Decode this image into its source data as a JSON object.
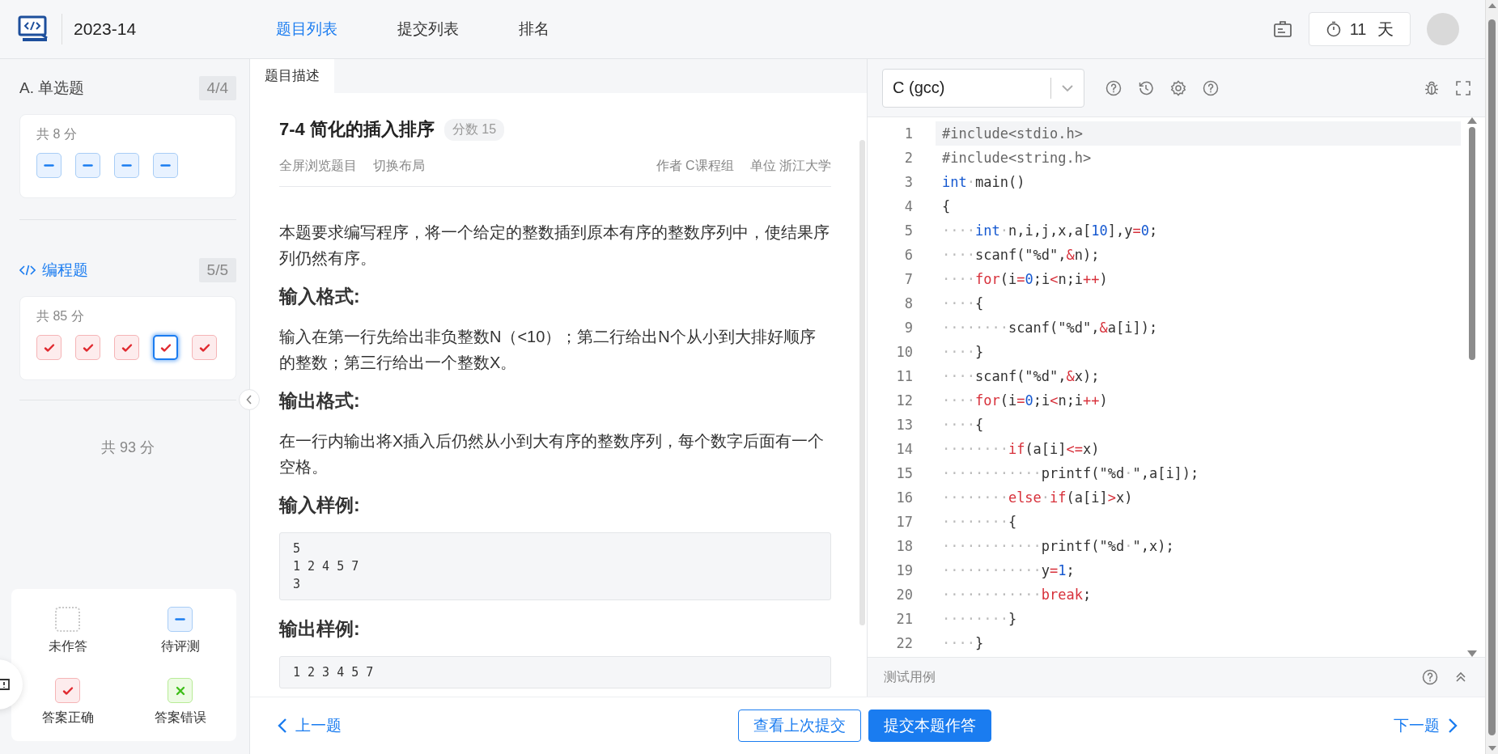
{
  "header": {
    "contest": "2023-14",
    "tabs": [
      {
        "label": "题目列表",
        "selected": true
      },
      {
        "label": "提交列表",
        "selected": false
      },
      {
        "label": "排名",
        "selected": false
      }
    ],
    "timer": "11 天"
  },
  "sidebar": {
    "sections": [
      {
        "kind": "choice",
        "prefix": "A.",
        "title": "单选题",
        "progress": "4/4",
        "selected": false,
        "score": "共 8 分",
        "items": [
          {
            "kind": "pending",
            "selected": false
          },
          {
            "kind": "pending",
            "selected": false
          },
          {
            "kind": "pending",
            "selected": false
          },
          {
            "kind": "pending",
            "selected": false
          }
        ]
      },
      {
        "kind": "code",
        "title": "编程题",
        "progress": "5/5",
        "selected": true,
        "score": "共 85 分",
        "items": [
          {
            "kind": "correct",
            "selected": false
          },
          {
            "kind": "correct",
            "selected": false
          },
          {
            "kind": "correct",
            "selected": false
          },
          {
            "kind": "correct",
            "selected": true
          },
          {
            "kind": "correct",
            "selected": false
          }
        ]
      }
    ],
    "total": "共 93 分",
    "legend": [
      {
        "kind": "unanswered",
        "label": "未作答"
      },
      {
        "kind": "pending",
        "label": "待评测"
      },
      {
        "kind": "correct",
        "label": "答案正确"
      },
      {
        "kind": "wrong",
        "label": "答案错误"
      }
    ]
  },
  "problem": {
    "tabs": [
      {
        "label": "题目描述",
        "selected": true
      }
    ],
    "title": "7-4 简化的插入排序",
    "score": "分数 15",
    "links": [
      "全屏浏览题目",
      "切换布局"
    ],
    "author": "作者 C课程组",
    "unit": "单位 浙江大学",
    "blocks": [
      {
        "kind": "p",
        "text": "本题要求编写程序，将一个给定的整数插到原本有序的整数序列中，使结果序列仍然有序。"
      },
      {
        "kind": "h",
        "text": "输入格式:"
      },
      {
        "kind": "p",
        "text": "输入在第一行先给出非负整数N（<10）；第二行给出N个从小到大排好顺序的整数；第三行给出一个整数X。"
      },
      {
        "kind": "h",
        "text": "输出格式:"
      },
      {
        "kind": "p",
        "text": "在一行内输出将X插入后仍然从小到大有序的整数序列，每个数字后面有一个空格。"
      },
      {
        "kind": "h",
        "text": "输入样例:"
      },
      {
        "kind": "pre",
        "text": "5\n1 2 4 5 7\n3"
      },
      {
        "kind": "h",
        "text": "输出样例:"
      },
      {
        "kind": "pre",
        "text": "1 2 3 4 5 7"
      }
    ]
  },
  "editor": {
    "language": "C (gcc)",
    "lines": [
      {
        "number": "1",
        "active": true,
        "tokens": [
          {
            "kind": "pp",
            "text": "#include<stdio.h>"
          }
        ]
      },
      {
        "number": "2",
        "active": false,
        "tokens": [
          {
            "kind": "pp",
            "text": "#include<string.h>"
          }
        ]
      },
      {
        "number": "3",
        "active": false,
        "tokens": [
          {
            "kind": "kw",
            "text": "int"
          },
          {
            "kind": "ws",
            "text": "·"
          },
          {
            "kind": "tx",
            "text": "main()"
          }
        ]
      },
      {
        "number": "4",
        "active": false,
        "tokens": [
          {
            "kind": "tx",
            "text": "{"
          }
        ]
      },
      {
        "number": "5",
        "active": false,
        "tokens": [
          {
            "kind": "ws",
            "text": "····"
          },
          {
            "kind": "kw",
            "text": "int"
          },
          {
            "kind": "ws",
            "text": "·"
          },
          {
            "kind": "tx",
            "text": "n,i,j,x,a["
          },
          {
            "kind": "num",
            "text": "10"
          },
          {
            "kind": "tx",
            "text": "],y"
          },
          {
            "kind": "op",
            "text": "="
          },
          {
            "kind": "num",
            "text": "0"
          },
          {
            "kind": "tx",
            "text": ";"
          }
        ]
      },
      {
        "number": "6",
        "active": false,
        "tokens": [
          {
            "kind": "ws",
            "text": "····"
          },
          {
            "kind": "tx",
            "text": "scanf(\"%d\","
          },
          {
            "kind": "op",
            "text": "&"
          },
          {
            "kind": "tx",
            "text": "n);"
          }
        ]
      },
      {
        "number": "7",
        "active": false,
        "tokens": [
          {
            "kind": "ws",
            "text": "····"
          },
          {
            "kind": "ctl",
            "text": "for"
          },
          {
            "kind": "tx",
            "text": "(i"
          },
          {
            "kind": "op",
            "text": "="
          },
          {
            "kind": "num",
            "text": "0"
          },
          {
            "kind": "tx",
            "text": ";i"
          },
          {
            "kind": "op",
            "text": "<"
          },
          {
            "kind": "tx",
            "text": "n;i"
          },
          {
            "kind": "op",
            "text": "++"
          },
          {
            "kind": "tx",
            "text": ")"
          }
        ]
      },
      {
        "number": "8",
        "active": false,
        "tokens": [
          {
            "kind": "ws",
            "text": "····"
          },
          {
            "kind": "tx",
            "text": "{"
          }
        ]
      },
      {
        "number": "9",
        "active": false,
        "tokens": [
          {
            "kind": "ws",
            "text": "········"
          },
          {
            "kind": "tx",
            "text": "scanf(\"%d\","
          },
          {
            "kind": "op",
            "text": "&"
          },
          {
            "kind": "tx",
            "text": "a[i]);"
          }
        ]
      },
      {
        "number": "10",
        "active": false,
        "tokens": [
          {
            "kind": "ws",
            "text": "····"
          },
          {
            "kind": "tx",
            "text": "}"
          }
        ]
      },
      {
        "number": "11",
        "active": false,
        "tokens": [
          {
            "kind": "ws",
            "text": "····"
          },
          {
            "kind": "tx",
            "text": "scanf(\"%d\","
          },
          {
            "kind": "op",
            "text": "&"
          },
          {
            "kind": "tx",
            "text": "x);"
          }
        ]
      },
      {
        "number": "12",
        "active": false,
        "tokens": [
          {
            "kind": "ws",
            "text": "····"
          },
          {
            "kind": "ctl",
            "text": "for"
          },
          {
            "kind": "tx",
            "text": "(i"
          },
          {
            "kind": "op",
            "text": "="
          },
          {
            "kind": "num",
            "text": "0"
          },
          {
            "kind": "tx",
            "text": ";i"
          },
          {
            "kind": "op",
            "text": "<"
          },
          {
            "kind": "tx",
            "text": "n;i"
          },
          {
            "kind": "op",
            "text": "++"
          },
          {
            "kind": "tx",
            "text": ")"
          }
        ]
      },
      {
        "number": "13",
        "active": false,
        "tokens": [
          {
            "kind": "ws",
            "text": "····"
          },
          {
            "kind": "tx",
            "text": "{"
          }
        ]
      },
      {
        "number": "14",
        "active": false,
        "tokens": [
          {
            "kind": "ws",
            "text": "········"
          },
          {
            "kind": "ctl",
            "text": "if"
          },
          {
            "kind": "tx",
            "text": "(a[i]"
          },
          {
            "kind": "op",
            "text": "<="
          },
          {
            "kind": "tx",
            "text": "x)"
          }
        ]
      },
      {
        "number": "15",
        "active": false,
        "tokens": [
          {
            "kind": "ws",
            "text": "············"
          },
          {
            "kind": "tx",
            "text": "printf(\"%d"
          },
          {
            "kind": "ws",
            "text": "·"
          },
          {
            "kind": "tx",
            "text": "\",a[i]);"
          }
        ]
      },
      {
        "number": "16",
        "active": false,
        "tokens": [
          {
            "kind": "ws",
            "text": "········"
          },
          {
            "kind": "ctl",
            "text": "else"
          },
          {
            "kind": "ws",
            "text": "·"
          },
          {
            "kind": "ctl",
            "text": "if"
          },
          {
            "kind": "tx",
            "text": "(a[i]"
          },
          {
            "kind": "op",
            "text": ">"
          },
          {
            "kind": "tx",
            "text": "x)"
          }
        ]
      },
      {
        "number": "17",
        "active": false,
        "tokens": [
          {
            "kind": "ws",
            "text": "········"
          },
          {
            "kind": "tx",
            "text": "{"
          }
        ]
      },
      {
        "number": "18",
        "active": false,
        "tokens": [
          {
            "kind": "ws",
            "text": "············"
          },
          {
            "kind": "tx",
            "text": "printf(\"%d"
          },
          {
            "kind": "ws",
            "text": "·"
          },
          {
            "kind": "tx",
            "text": "\",x);"
          }
        ]
      },
      {
        "number": "19",
        "active": false,
        "tokens": [
          {
            "kind": "ws",
            "text": "············"
          },
          {
            "kind": "tx",
            "text": "y"
          },
          {
            "kind": "op",
            "text": "="
          },
          {
            "kind": "num",
            "text": "1"
          },
          {
            "kind": "tx",
            "text": ";"
          }
        ]
      },
      {
        "number": "20",
        "active": false,
        "tokens": [
          {
            "kind": "ws",
            "text": "············"
          },
          {
            "kind": "ctl",
            "text": "break"
          },
          {
            "kind": "tx",
            "text": ";"
          }
        ]
      },
      {
        "number": "21",
        "active": false,
        "tokens": [
          {
            "kind": "ws",
            "text": "········"
          },
          {
            "kind": "tx",
            "text": "}"
          }
        ]
      },
      {
        "number": "22",
        "active": false,
        "tokens": [
          {
            "kind": "ws",
            "text": "····"
          },
          {
            "kind": "tx",
            "text": "}"
          }
        ]
      }
    ],
    "test_cases": "测试用例"
  },
  "footer": {
    "prev": "上一题",
    "view_last": "查看上次提交",
    "submit": "提交本题作答",
    "next": "下一题"
  }
}
